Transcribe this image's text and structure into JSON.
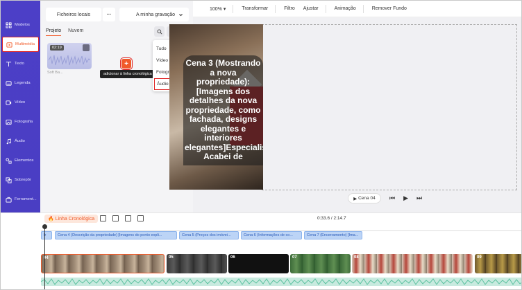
{
  "sidebar": {
    "items": [
      {
        "label": "Modelos",
        "icon": "grid-icon"
      },
      {
        "label": "Multimédia",
        "icon": "media-icon",
        "active": true
      },
      {
        "label": "Texto",
        "icon": "text-icon"
      },
      {
        "label": "Legenda",
        "icon": "caption-icon"
      },
      {
        "label": "Vídeo",
        "icon": "video-icon"
      },
      {
        "label": "Fotografia",
        "icon": "photo-icon"
      },
      {
        "label": "Áudio",
        "icon": "music-icon"
      },
      {
        "label": "Elementos",
        "icon": "elements-icon"
      },
      {
        "label": "Sobrepôr",
        "icon": "overlay-icon"
      },
      {
        "label": "Ferrament...",
        "icon": "toolbox-icon"
      }
    ]
  },
  "media": {
    "local_files": "Ficheiros locais",
    "more": "···",
    "recording": "A minha gravação",
    "tabs": [
      "Projeto",
      "Nuvem"
    ],
    "thumb_duration": "02:19",
    "thumb_name": "Soft Ba...",
    "tooltip": "adicionar à linha cronológica",
    "add_symbol": "+",
    "filter_options": [
      "Tudo",
      "Vídeo",
      "Fotografia",
      "Áudio"
    ],
    "filter_selected": "Áudio"
  },
  "toolbar": {
    "zoom": "100%",
    "items": [
      "Transformar",
      "Filtro",
      "Ajustar",
      "Animação",
      "Remover Fundo"
    ]
  },
  "preview": {
    "caption": "Cena 3 (Mostrando a nova propriedade): [Imagens dos detalhes da nova propriedade, como fachada, designs elegantes e interiores elegantes]Especialista: Acabei de",
    "scene_label": "Cena 04"
  },
  "timeline": {
    "label": "Linha Cronológica",
    "time": "0:33.6 / 2:14.7",
    "scenes": [
      "Cena 4 (Descrição da propriedade) [Imagens do ponto expli...",
      "Cena 5 (Preços dos imóvei...",
      "Cena 6 (Informações de co...",
      "Cena 7 (Encerramento) [Ima..."
    ],
    "clip_numbers": [
      "04",
      "05",
      "06",
      "07",
      "08",
      "09"
    ]
  },
  "colors": {
    "sidebar": "#4a3ec3",
    "accent": "#f15a29",
    "highlight": "#e02424",
    "scene_chip": "#bcd4f6",
    "audio": "#c8eadf"
  }
}
